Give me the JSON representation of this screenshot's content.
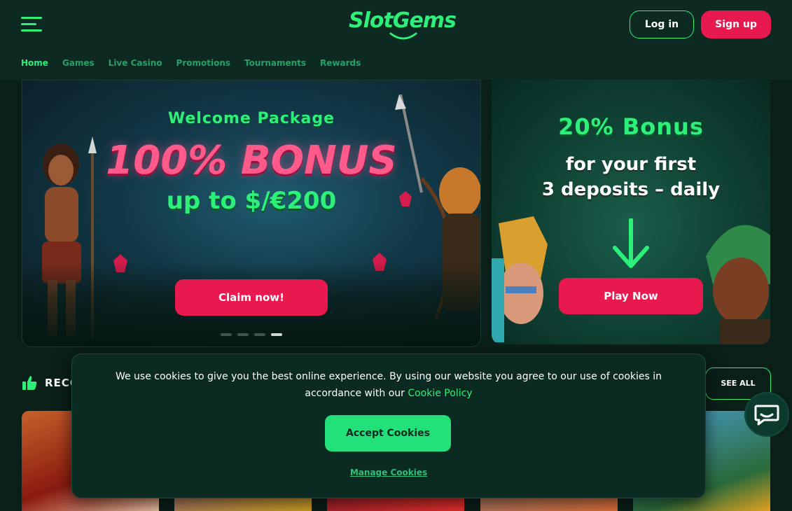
{
  "header": {
    "logo_text": "SlotGems",
    "login_label": "Log in",
    "signup_label": "Sign up",
    "nav": [
      "Home",
      "Games",
      "Live Casino",
      "Promotions",
      "Tournaments",
      "Rewards"
    ]
  },
  "hero_left": {
    "subtitle": "Welcome Package",
    "headline": "100% BONUS",
    "offer": "up to $/€200",
    "cta_label": "Claim now!",
    "slides_total": 4,
    "slide_active": 4
  },
  "hero_right": {
    "headline": "20% Bonus",
    "line1": "for your first",
    "line2": "3 deposits – daily",
    "cta_label": "Play Now"
  },
  "section": {
    "title_visible": "RECO",
    "see_all_label": "SEE ALL"
  },
  "cookie": {
    "text_before": "We use cookies to give you the best online experience. By using our website you agree to our use of cookies in accordance with our ",
    "policy_link": "Cookie Policy",
    "accept_label": "Accept Cookies",
    "manage_label": "Manage Cookies"
  },
  "colors": {
    "accent_green": "#2cf07a",
    "accent_pink": "#e8194e",
    "background": "#0b1f19"
  }
}
